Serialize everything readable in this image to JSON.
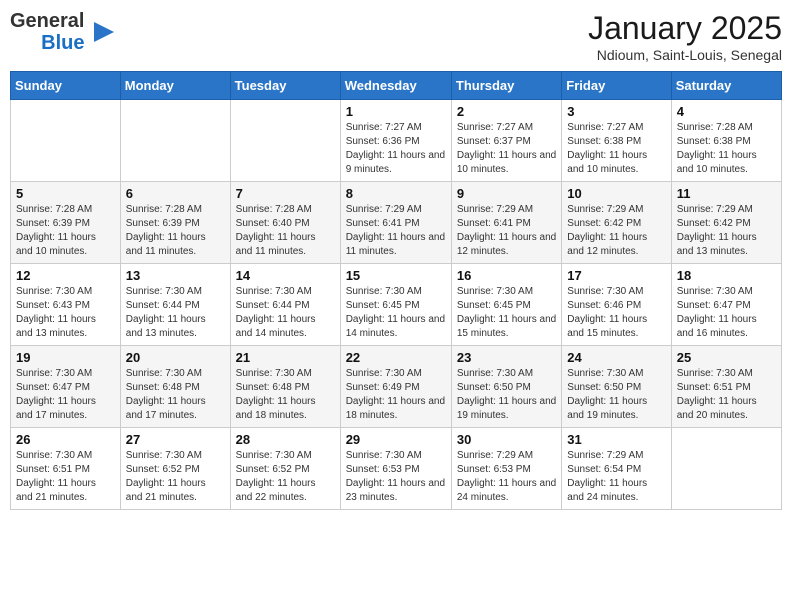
{
  "header": {
    "logo_general": "General",
    "logo_blue": "Blue",
    "month_title": "January 2025",
    "subtitle": "Ndioum, Saint-Louis, Senegal"
  },
  "weekdays": [
    "Sunday",
    "Monday",
    "Tuesday",
    "Wednesday",
    "Thursday",
    "Friday",
    "Saturday"
  ],
  "weeks": [
    [
      {
        "day": "",
        "info": ""
      },
      {
        "day": "",
        "info": ""
      },
      {
        "day": "",
        "info": ""
      },
      {
        "day": "1",
        "info": "Sunrise: 7:27 AM\nSunset: 6:36 PM\nDaylight: 11 hours and 9 minutes."
      },
      {
        "day": "2",
        "info": "Sunrise: 7:27 AM\nSunset: 6:37 PM\nDaylight: 11 hours and 10 minutes."
      },
      {
        "day": "3",
        "info": "Sunrise: 7:27 AM\nSunset: 6:38 PM\nDaylight: 11 hours and 10 minutes."
      },
      {
        "day": "4",
        "info": "Sunrise: 7:28 AM\nSunset: 6:38 PM\nDaylight: 11 hours and 10 minutes."
      }
    ],
    [
      {
        "day": "5",
        "info": "Sunrise: 7:28 AM\nSunset: 6:39 PM\nDaylight: 11 hours and 10 minutes."
      },
      {
        "day": "6",
        "info": "Sunrise: 7:28 AM\nSunset: 6:39 PM\nDaylight: 11 hours and 11 minutes."
      },
      {
        "day": "7",
        "info": "Sunrise: 7:28 AM\nSunset: 6:40 PM\nDaylight: 11 hours and 11 minutes."
      },
      {
        "day": "8",
        "info": "Sunrise: 7:29 AM\nSunset: 6:41 PM\nDaylight: 11 hours and 11 minutes."
      },
      {
        "day": "9",
        "info": "Sunrise: 7:29 AM\nSunset: 6:41 PM\nDaylight: 11 hours and 12 minutes."
      },
      {
        "day": "10",
        "info": "Sunrise: 7:29 AM\nSunset: 6:42 PM\nDaylight: 11 hours and 12 minutes."
      },
      {
        "day": "11",
        "info": "Sunrise: 7:29 AM\nSunset: 6:42 PM\nDaylight: 11 hours and 13 minutes."
      }
    ],
    [
      {
        "day": "12",
        "info": "Sunrise: 7:30 AM\nSunset: 6:43 PM\nDaylight: 11 hours and 13 minutes."
      },
      {
        "day": "13",
        "info": "Sunrise: 7:30 AM\nSunset: 6:44 PM\nDaylight: 11 hours and 13 minutes."
      },
      {
        "day": "14",
        "info": "Sunrise: 7:30 AM\nSunset: 6:44 PM\nDaylight: 11 hours and 14 minutes."
      },
      {
        "day": "15",
        "info": "Sunrise: 7:30 AM\nSunset: 6:45 PM\nDaylight: 11 hours and 14 minutes."
      },
      {
        "day": "16",
        "info": "Sunrise: 7:30 AM\nSunset: 6:45 PM\nDaylight: 11 hours and 15 minutes."
      },
      {
        "day": "17",
        "info": "Sunrise: 7:30 AM\nSunset: 6:46 PM\nDaylight: 11 hours and 15 minutes."
      },
      {
        "day": "18",
        "info": "Sunrise: 7:30 AM\nSunset: 6:47 PM\nDaylight: 11 hours and 16 minutes."
      }
    ],
    [
      {
        "day": "19",
        "info": "Sunrise: 7:30 AM\nSunset: 6:47 PM\nDaylight: 11 hours and 17 minutes."
      },
      {
        "day": "20",
        "info": "Sunrise: 7:30 AM\nSunset: 6:48 PM\nDaylight: 11 hours and 17 minutes."
      },
      {
        "day": "21",
        "info": "Sunrise: 7:30 AM\nSunset: 6:48 PM\nDaylight: 11 hours and 18 minutes."
      },
      {
        "day": "22",
        "info": "Sunrise: 7:30 AM\nSunset: 6:49 PM\nDaylight: 11 hours and 18 minutes."
      },
      {
        "day": "23",
        "info": "Sunrise: 7:30 AM\nSunset: 6:50 PM\nDaylight: 11 hours and 19 minutes."
      },
      {
        "day": "24",
        "info": "Sunrise: 7:30 AM\nSunset: 6:50 PM\nDaylight: 11 hours and 19 minutes."
      },
      {
        "day": "25",
        "info": "Sunrise: 7:30 AM\nSunset: 6:51 PM\nDaylight: 11 hours and 20 minutes."
      }
    ],
    [
      {
        "day": "26",
        "info": "Sunrise: 7:30 AM\nSunset: 6:51 PM\nDaylight: 11 hours and 21 minutes."
      },
      {
        "day": "27",
        "info": "Sunrise: 7:30 AM\nSunset: 6:52 PM\nDaylight: 11 hours and 21 minutes."
      },
      {
        "day": "28",
        "info": "Sunrise: 7:30 AM\nSunset: 6:52 PM\nDaylight: 11 hours and 22 minutes."
      },
      {
        "day": "29",
        "info": "Sunrise: 7:30 AM\nSunset: 6:53 PM\nDaylight: 11 hours and 23 minutes."
      },
      {
        "day": "30",
        "info": "Sunrise: 7:29 AM\nSunset: 6:53 PM\nDaylight: 11 hours and 24 minutes."
      },
      {
        "day": "31",
        "info": "Sunrise: 7:29 AM\nSunset: 6:54 PM\nDaylight: 11 hours and 24 minutes."
      },
      {
        "day": "",
        "info": ""
      }
    ]
  ]
}
